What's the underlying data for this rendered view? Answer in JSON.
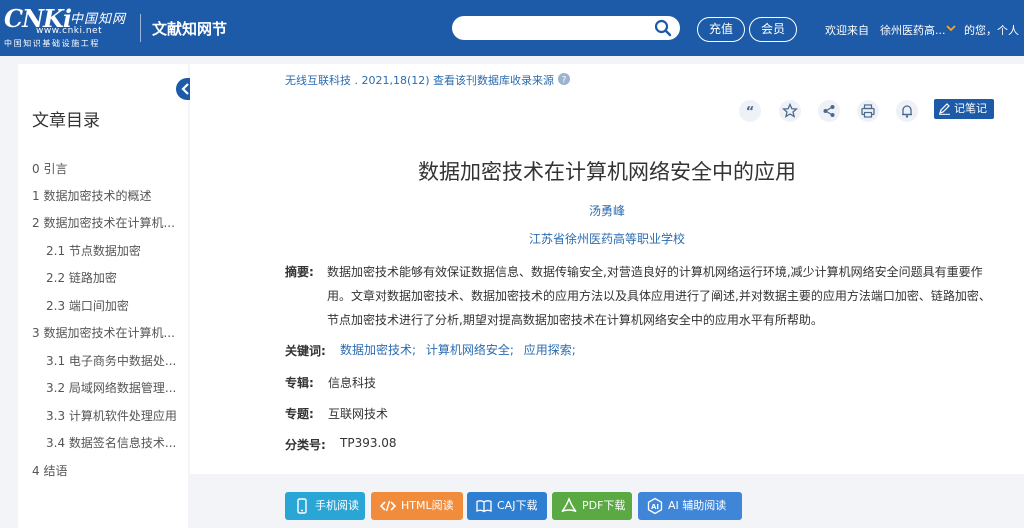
{
  "header": {
    "logo_main": "CNKi",
    "logo_cn": "中国知网",
    "logo_url": "www.cnki.net",
    "logo_sub": "中国知识基础设施工程",
    "site_section": "文献知网节",
    "search_placeholder": "",
    "recharge": "充值",
    "member": "会员",
    "welcome": "欢迎来自",
    "institution": "徐州医药高...",
    "user_greeting": "的您，个人"
  },
  "sidebar": {
    "title": "文章目录",
    "items": [
      {
        "label": "0 引言"
      },
      {
        "label": "1 数据加密技术的概述"
      },
      {
        "label": "2 数据加密技术在计算机..."
      },
      {
        "label": "2.1 节点数据加密"
      },
      {
        "label": "2.2 链路加密"
      },
      {
        "label": "2.3 端口间加密"
      },
      {
        "label": "3 数据加密技术在计算机..."
      },
      {
        "label": "3.1 电子商务中数据处..."
      },
      {
        "label": "3.2 局域网络数据管理..."
      },
      {
        "label": "3.3 计算机软件处理应用"
      },
      {
        "label": "3.4 数据签名信息技术..."
      },
      {
        "label": "4 结语"
      }
    ]
  },
  "article": {
    "source": "无线互联科技 . 2021,18(12)  查看该刊数据库收录来源",
    "note_btn": "记笔记",
    "title": "数据加密技术在计算机网络安全中的应用",
    "author": "汤勇峰",
    "organization": "江苏省徐州医药高等职业学校",
    "abstract_label": "摘要:",
    "abstract": "数据加密技术能够有效保证数据信息、数据传输安全,对营造良好的计算机网络运行环境,减少计算机网络安全问题具有重要作用。文章对数据加密技术、数据加密技术的应用方法以及具体应用进行了阐述,并对数据主要的应用方法端口加密、链路加密、节点加密技术进行了分析,期望对提高数据加密技术在计算机网络安全中的应用水平有所帮助。",
    "keywords_label": "关键词:",
    "keywords": [
      "数据加密技术;",
      "计算机网络安全;",
      "应用探索;"
    ],
    "special_label": "专辑:",
    "special": "信息科技",
    "topic_label": "专题:",
    "topic": "互联网技术",
    "class_label": "分类号:",
    "class_no": "TP393.08"
  },
  "toolbar_icons": [
    "quote-icon",
    "star-icon",
    "share-icon",
    "print-icon",
    "bell-icon"
  ],
  "downloads": {
    "mobile": "手机阅读",
    "html": "HTML阅读",
    "caj": "CAJ下载",
    "pdf": "PDF下载",
    "ai": "AI 辅助阅读"
  },
  "colors": {
    "header": "#1d5aa8",
    "link": "#2b6cb0",
    "mobile": "#2aa6d6",
    "html": "#f08c3c",
    "caj": "#2e7fd2",
    "pdf": "#5aa943",
    "ai": "#3f86d8"
  }
}
